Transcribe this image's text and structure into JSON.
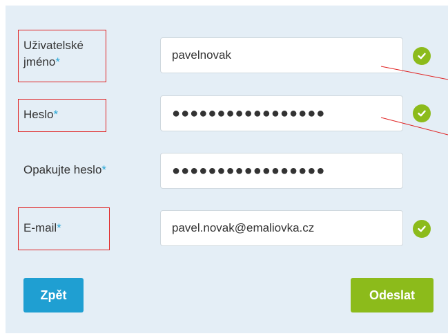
{
  "form": {
    "username": {
      "label": "Uživatelské",
      "label_line2": "jméno",
      "required_mark": "*",
      "value": "pavelnovak",
      "valid": true
    },
    "password": {
      "label": "Heslo",
      "required_mark": "*",
      "value": "●●●●●●●●●●●●●●●●●",
      "valid": true
    },
    "password_repeat": {
      "label": "Opakujte heslo",
      "required_mark": "*",
      "value": "●●●●●●●●●●●●●●●●●"
    },
    "email": {
      "label": "E-mail",
      "required_mark": "*",
      "value": "pavel.novak@emaliovka.cz",
      "valid": true
    }
  },
  "buttons": {
    "back_label": "Zpět",
    "submit_label": "Odeslat"
  },
  "icons": {
    "valid": "check-circle-icon"
  },
  "colors": {
    "panel_bg": "#e4eef6",
    "accent_blue": "#1f9fd2",
    "accent_green": "#8cbb1b",
    "required_star": "#2aa7d6",
    "annotation": "#e02020"
  }
}
